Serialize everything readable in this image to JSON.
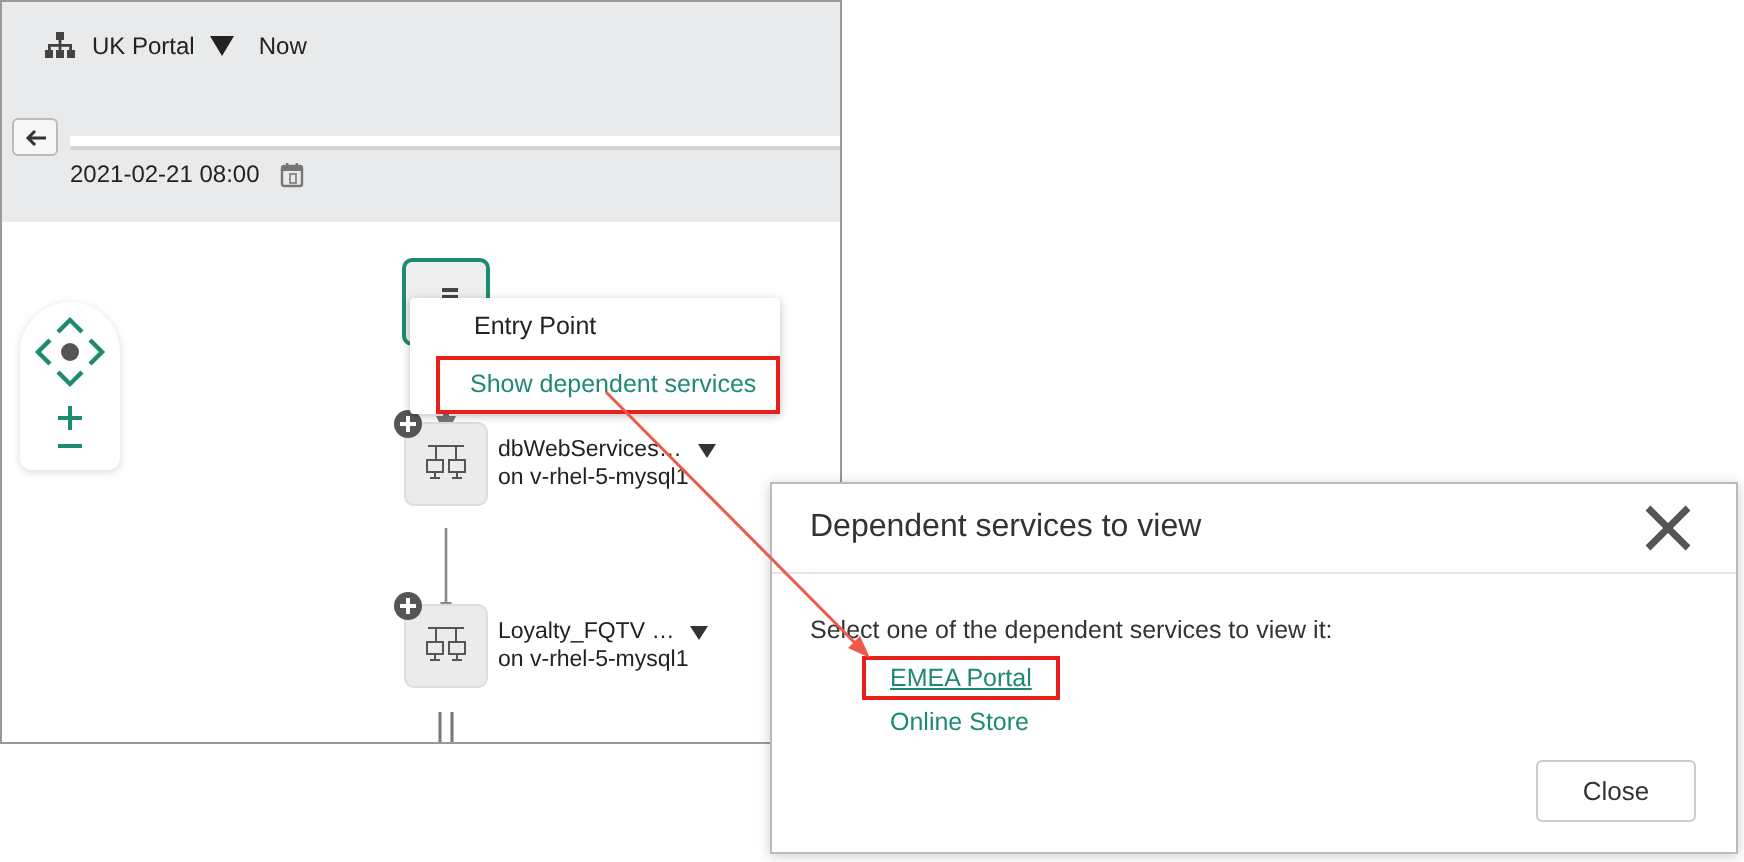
{
  "toolbar": {
    "service": "UK Portal",
    "time_mode": "Now"
  },
  "date": "2021-02-21 08:00",
  "context_menu": [
    {
      "label": "Entry Point",
      "highlighted": false
    },
    {
      "label": "Show dependent services",
      "highlighted": true
    }
  ],
  "nodes": [
    {
      "name": "dbWebServices…",
      "host": "on v-rhel-5-mysql1"
    },
    {
      "name": "Loyalty_FQTV …",
      "host": "on v-rhel-5-mysql1"
    }
  ],
  "dialog": {
    "title": "Dependent services to view",
    "message": "Select one of the dependent services to view it:",
    "services": [
      {
        "label": "EMEA Portal",
        "highlighted": true,
        "hovered": true
      },
      {
        "label": "Online Store",
        "highlighted": false,
        "hovered": false
      }
    ],
    "button": "Close"
  }
}
